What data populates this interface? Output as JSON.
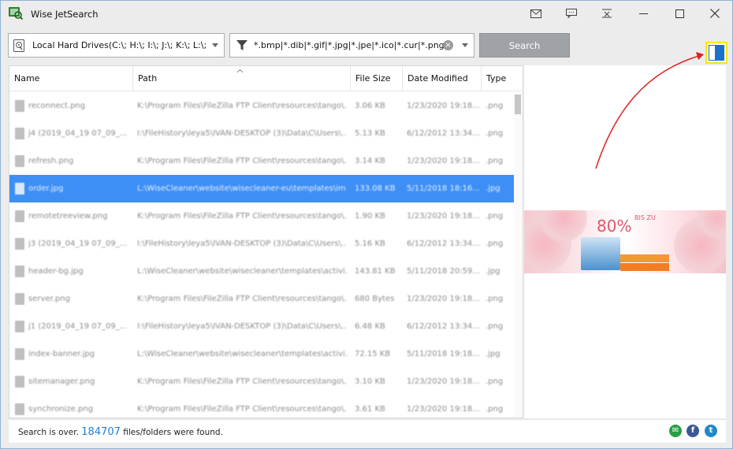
{
  "window": {
    "title": "Wise JetSearch",
    "icons": [
      "feedback-mail-icon",
      "comment-icon",
      "skin-icon",
      "minimize-icon",
      "maximize-icon",
      "close-icon"
    ]
  },
  "toolbar": {
    "drive_value": "Local Hard Drives(C:\\; H:\\; I:\\; J:\\; K:\\; L:\\; M",
    "filter_value": "*.bmp|*.dib|*.gif|*.jpg|*.jpe|*.ico|*.cur|*.png",
    "search_label": "Search"
  },
  "table": {
    "columns": [
      "Name",
      "Path",
      "File Size",
      "Date Modified",
      "Type"
    ],
    "rows": [
      {
        "name": "reconnect.png",
        "path": "K:\\Program Files\\FileZilla FTP Client\\resources\\tango\\...",
        "size": "3.06 KB",
        "date": "1/23/2020 19:18...",
        "type": ".png"
      },
      {
        "name": "j4 (2019_04_19 07_09_...",
        "path": "I:\\FileHistory\\leya5\\IVAN-DESKTOP (3)\\Data\\C\\Users\\...",
        "size": "5.13 KB",
        "date": "6/12/2012 13:34...",
        "type": ".png"
      },
      {
        "name": "refresh.png",
        "path": "K:\\Program Files\\FileZilla FTP Client\\resources\\tango\\...",
        "size": "3.14 KB",
        "date": "1/23/2020 19:18...",
        "type": ".png"
      },
      {
        "name": "order.jpg",
        "path": "L:\\WiseCleaner\\website\\wisecleaner-eu\\templates\\im...",
        "size": "133.08 KB",
        "date": "5/11/2018 18:16...",
        "type": ".jpg"
      },
      {
        "name": "remotetreeview.png",
        "path": "K:\\Program Files\\FileZilla FTP Client\\resources\\tango\\...",
        "size": "1.90 KB",
        "date": "1/23/2020 19:18...",
        "type": ".png"
      },
      {
        "name": "j3 (2019_04_19 07_09_...",
        "path": "I:\\FileHistory\\leya5\\IVAN-DESKTOP (3)\\Data\\C\\Users\\...",
        "size": "5.16 KB",
        "date": "6/12/2012 13:34...",
        "type": ".png"
      },
      {
        "name": "header-bg.jpg",
        "path": "L:\\WiseCleaner\\website\\wisecleaner\\templates\\activi...",
        "size": "143.81 KB",
        "date": "5/11/2018 20:59...",
        "type": ".jpg"
      },
      {
        "name": "server.png",
        "path": "K:\\Program Files\\FileZilla FTP Client\\resources\\tango\\...",
        "size": "680 Bytes",
        "date": "1/23/2020 19:18...",
        "type": ".png"
      },
      {
        "name": "j1 (2019_04_19 07_09_...",
        "path": "I:\\FileHistory\\leya5\\IVAN-DESKTOP (3)\\Data\\C\\Users\\...",
        "size": "6.48 KB",
        "date": "6/12/2012 13:34...",
        "type": ".png"
      },
      {
        "name": "index-banner.jpg",
        "path": "L:\\WiseCleaner\\website\\wisecleaner\\templates\\activi...",
        "size": "72.15 KB",
        "date": "5/11/2018 19:18...",
        "type": ".jpg"
      },
      {
        "name": "sitemanager.png",
        "path": "K:\\Program Files\\FileZilla FTP Client\\resources\\tango\\...",
        "size": "3.10 KB",
        "date": "1/23/2020 19:18...",
        "type": ".png"
      },
      {
        "name": "synchronize.png",
        "path": "K:\\Program Files\\FileZilla FTP Client\\resources\\tango\\...",
        "size": "3.61 KB",
        "date": "1/23/2020 19:18...",
        "type": ".png"
      }
    ],
    "selected_row": 3
  },
  "ad": {
    "percent": "80%",
    "upto": "BIS ZU"
  },
  "status": {
    "prefix": "Search is over.",
    "count": "184707",
    "suffix": "files/folders were found."
  },
  "colors": {
    "selection": "#3d8ff5",
    "accent": "#1c7fd1",
    "highlight_box": "#f5e900",
    "annotation_arrow": "#e02020"
  }
}
